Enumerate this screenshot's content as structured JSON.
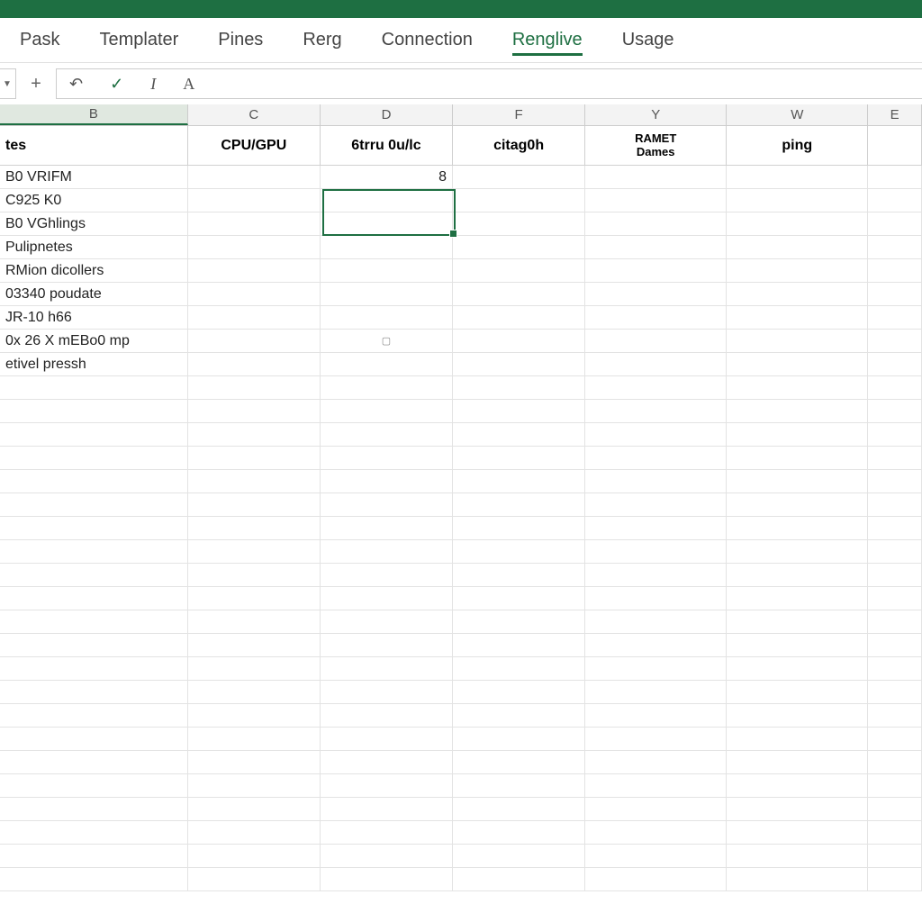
{
  "ribbon": {
    "tabs": [
      "Pask",
      "Templater",
      "Pines",
      "Rerg",
      "Connection",
      "Renglive",
      "Usage"
    ],
    "active_index": 5
  },
  "formula_bar": {
    "name_box_value": "",
    "input_value": ""
  },
  "columns": [
    "B",
    "C",
    "D",
    "F",
    "Y",
    "W",
    "E"
  ],
  "selected_col_index": 0,
  "headers": {
    "b": "tes",
    "c": "CPU/GPU",
    "d": "6trru 0u/lc",
    "f": "citag0h",
    "y_line1": "RAMET",
    "y_line2": "Dames",
    "w": "ping"
  },
  "rows": [
    {
      "b": "B0 VRIFM",
      "d": "8"
    },
    {
      "b": "C925 K0"
    },
    {
      "b": "B0 VGhlings"
    },
    {
      "b": "Pulipnetes"
    },
    {
      "b": "RMion dicollers"
    },
    {
      "b": "03340 poudate"
    },
    {
      "b": "JR-10 h66"
    },
    {
      "b": "0x 26 X mEBo0 mp",
      "d_glyph": "▢"
    },
    {
      "b": "etivel pressh"
    }
  ],
  "selection": {
    "col": "D",
    "row_index": 1
  },
  "empty_row_count": 22
}
